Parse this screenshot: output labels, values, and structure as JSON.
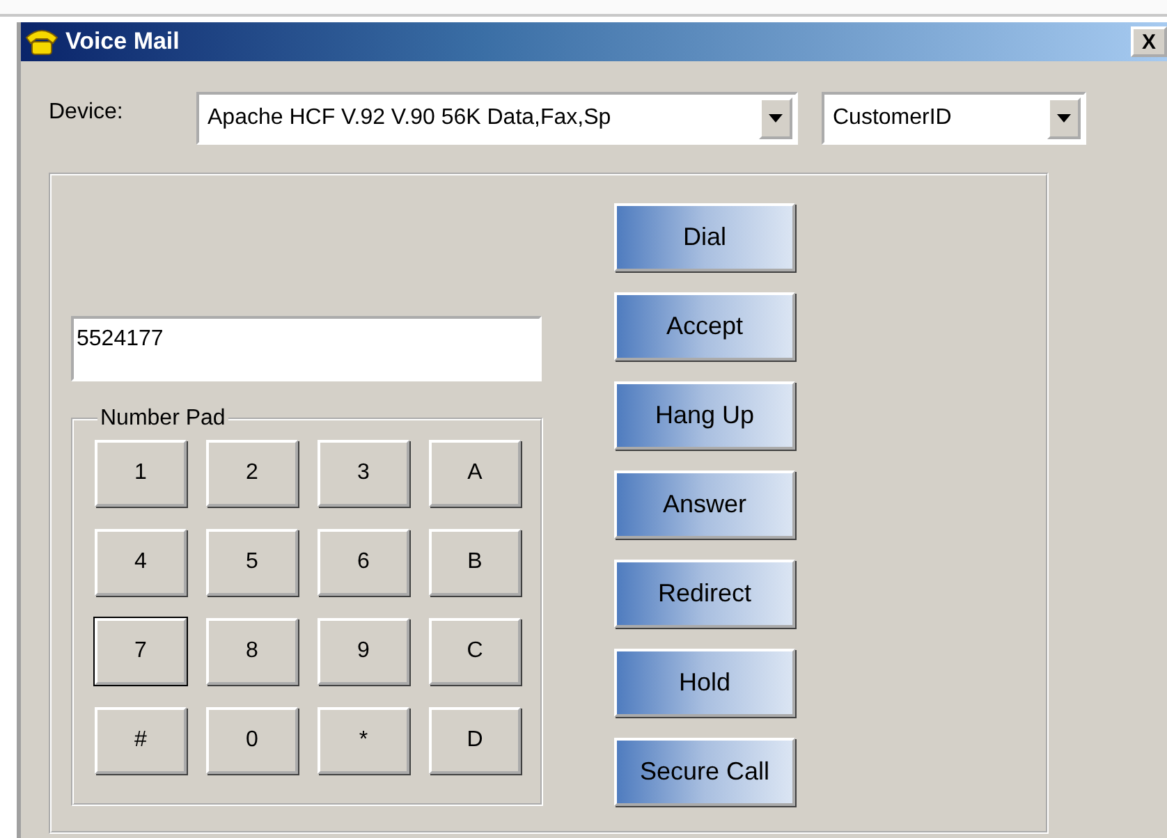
{
  "window": {
    "title": "Voice Mail",
    "close_label": "X"
  },
  "device": {
    "label": "Device:",
    "value": "Apache HCF V.92 V.90 56K Data,Fax,Sp",
    "id_field": "CustomerID"
  },
  "number_field": {
    "value": "5524177"
  },
  "number_pad": {
    "title": "Number Pad",
    "keys": [
      {
        "label": "1",
        "focused": false
      },
      {
        "label": "2",
        "focused": false
      },
      {
        "label": "3",
        "focused": false
      },
      {
        "label": "A",
        "focused": false
      },
      {
        "label": "4",
        "focused": false
      },
      {
        "label": "5",
        "focused": false
      },
      {
        "label": "6",
        "focused": false
      },
      {
        "label": "B",
        "focused": false
      },
      {
        "label": "7",
        "focused": true
      },
      {
        "label": "8",
        "focused": false
      },
      {
        "label": "9",
        "focused": false
      },
      {
        "label": "C",
        "focused": false
      },
      {
        "label": "#",
        "focused": false
      },
      {
        "label": "0",
        "focused": false
      },
      {
        "label": "*",
        "focused": false
      },
      {
        "label": "D",
        "focused": false
      }
    ]
  },
  "actions": [
    "Dial",
    "Accept",
    "Hang Up",
    "Answer",
    "Redirect",
    "Hold",
    "Secure Call"
  ]
}
